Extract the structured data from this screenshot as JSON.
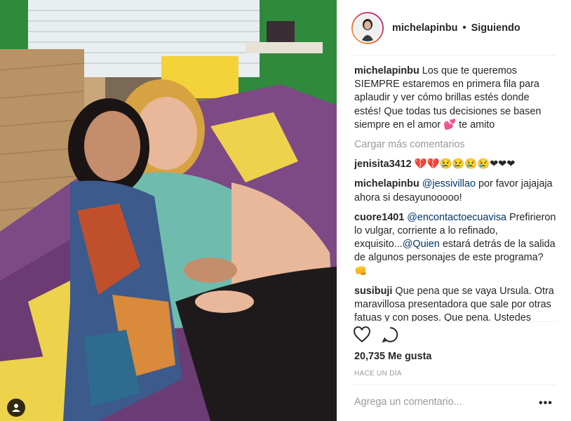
{
  "post": {
    "username": "michelapinbu",
    "separator": "•",
    "follow_status": "Siguiendo",
    "caption": {
      "user": "michelapinbu",
      "text": "Los que te queremos SIEMPRE estaremos en primera fila para aplaudir y ver cómo brillas estés donde estés! Que todas tus decisiones se basen siempre en el amor",
      "emoji": "💕",
      "text_after": "te amito"
    },
    "load_more": "Cargar más comentarios",
    "comments": [
      {
        "user": "jenisita3412",
        "text": "💔💔😢😢😢😢❤❤❤"
      },
      {
        "user": "michelapinbu",
        "mention": "@jessivillao",
        "text": "por favor jajajaja ahora si desayunooooo!"
      },
      {
        "user": "cuore1401",
        "mention": "@encontactoecuavisa",
        "text": "Prefirieron lo vulgar, corriente a lo refinado, exquisito...",
        "mention2": "@Quien",
        "text2": "estará detrás de la salida de algunos personajes de este programa? 👊"
      },
      {
        "user": "susibuji",
        "text": "Que pena que se vaya Ursula. Otra maravillosa presentadora que sale por otras fatuas y con poses. Que pena. Ustedes hacían un maravilloso programa. Eh dicho 😩😩😡"
      }
    ],
    "likes": "20,735 Me gusta",
    "time": "HACE UN DÍA",
    "add_comment_placeholder": "Agrega un comentario...",
    "more_options": "•••"
  },
  "icons": {
    "like": "heart-outline-icon",
    "comment": "speech-bubble-icon",
    "tag": "user-tag-icon",
    "more": "ellipsis-icon"
  },
  "colors": {
    "text": "#262626",
    "secondary": "#999999",
    "mention": "#003569",
    "border": "#efefef"
  }
}
